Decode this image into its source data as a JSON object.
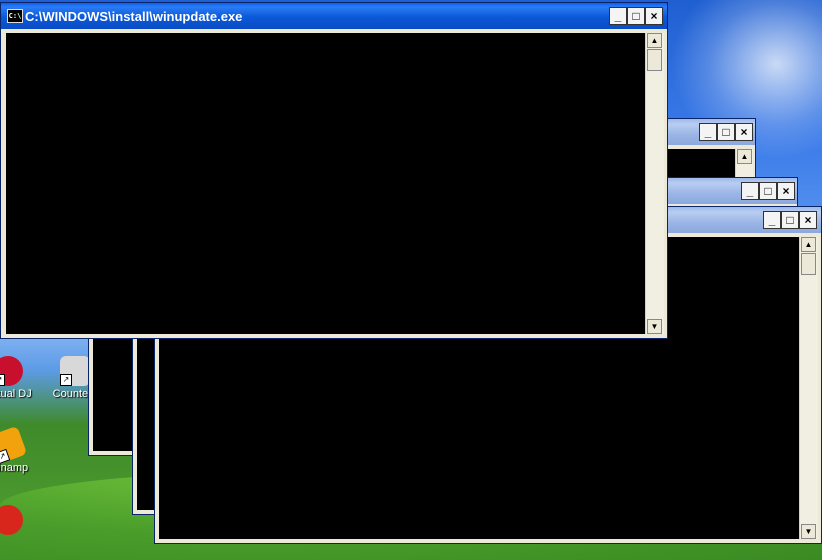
{
  "windows": {
    "main": {
      "title": "C:\\WINDOWS\\install\\winupdate.exe",
      "icon": "console-icon",
      "icon_text": "C:\\"
    },
    "back1": {
      "title": ""
    },
    "back2": {
      "title": ""
    },
    "back3": {
      "title": ""
    }
  },
  "controls": {
    "minimize": "_",
    "maximize": "□",
    "close": "×"
  },
  "scroll": {
    "up": "▲",
    "down": "▼"
  },
  "desktop_icons": [
    {
      "label": "Virtual DJ",
      "icon": "virtual-dj-icon",
      "color": "#c8102e"
    },
    {
      "label": "Counte...",
      "icon": "counter-strike-icon",
      "color": "#d8d8d8"
    },
    {
      "label": "Winamp",
      "icon": "winamp-icon",
      "color": "#f2a20c"
    },
    {
      "label": "",
      "icon": "ccleaner-icon",
      "color": "#d9261c"
    }
  ]
}
